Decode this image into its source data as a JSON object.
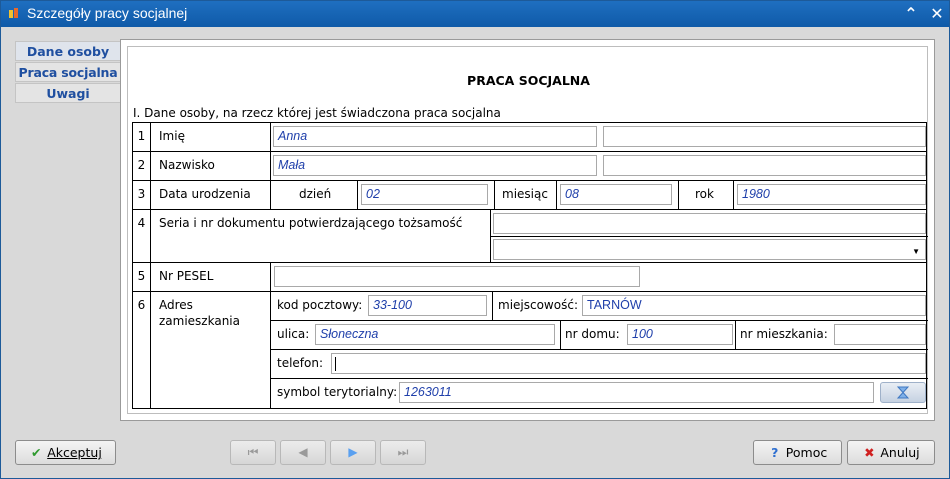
{
  "window": {
    "title": "Szczegóły pracy socjalnej"
  },
  "tabs": [
    {
      "label": "Dane osoby"
    },
    {
      "label": "Praca socjalna"
    },
    {
      "label": "Uwagi"
    }
  ],
  "form": {
    "heading": "PRACA SOCJALNA",
    "section": "I. Dane osoby, na rzecz której jest świadczona praca socjalna",
    "rows": {
      "r1": {
        "num": "1",
        "label": "Imię",
        "value": "Anna",
        "value2": ""
      },
      "r2": {
        "num": "2",
        "label": "Nazwisko",
        "value": "Mała",
        "value2": ""
      },
      "r3": {
        "num": "3",
        "label": "Data urodzenia",
        "day_label": "dzień",
        "day": "02",
        "month_label": "miesiąc",
        "month": "08",
        "year_label": "rok",
        "year": "1980"
      },
      "r4": {
        "num": "4",
        "label": "Seria i nr dokumentu potwierdzającego tożsamość",
        "doc_number": "",
        "doc_type": ""
      },
      "r5": {
        "num": "5",
        "label": "Nr PESEL",
        "value": ""
      },
      "r6": {
        "num": "6",
        "label_line1": "Adres",
        "label_line2": "zamieszkania",
        "postal_label": "kod pocztowy:",
        "postal": "33-100",
        "city_label": "miejscowość:",
        "city": "TARNÓW",
        "street_label": "ulica:",
        "street": "Słoneczna",
        "house_label": "nr domu:",
        "house": "100",
        "flat_label": "nr mieszkania:",
        "flat": "",
        "phone_label": "telefon:",
        "phone": "",
        "terr_label": "symbol terytorialny:",
        "terr": "1263011"
      }
    }
  },
  "footer": {
    "accept_label": "Akceptuj",
    "help_label": "Pomoc",
    "cancel_label": "Anuluj"
  },
  "colors": {
    "title_bar": "#1f6fc0",
    "tab_text": "#1f4fa0",
    "value_text": "#1f3faa"
  }
}
